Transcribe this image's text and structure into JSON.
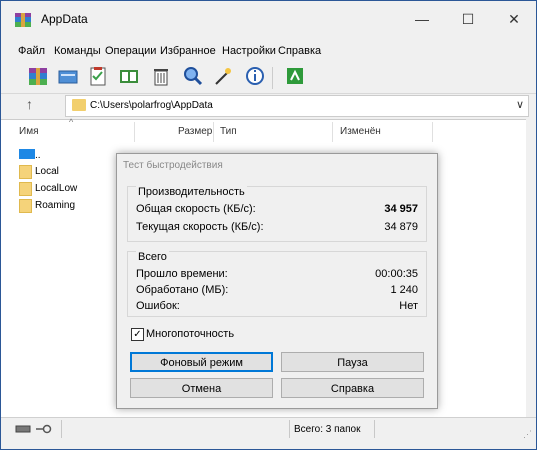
{
  "window": {
    "title": "AppData",
    "minimize_glyph": "—",
    "maximize_glyph": "☐",
    "close_glyph": "✕"
  },
  "menu": [
    "Файл",
    "Команды",
    "Операции",
    "Избранное",
    "Настройки",
    "Справка"
  ],
  "toolbar": {
    "icons": [
      "add-archive-icon",
      "extract-to-icon",
      "test-icon",
      "view-icon",
      "delete-icon",
      "find-icon",
      "wizard-icon",
      "info-icon",
      "repair-icon"
    ]
  },
  "address": {
    "path": "C:\\Users\\polarfrog\\AppData",
    "up_glyph": "↑",
    "dropdown_glyph": "∨"
  },
  "filelist": {
    "columns": [
      "Имя",
      "Размер",
      "Тип",
      "Изменён"
    ],
    "sort_glyph": "^",
    "rows": [
      {
        "name": "..",
        "kind": "up"
      },
      {
        "name": "Local",
        "kind": "folder"
      },
      {
        "name": "LocalLow",
        "kind": "folder"
      },
      {
        "name": "Roaming",
        "kind": "folder"
      }
    ]
  },
  "status": {
    "text": "Всего: 3 папок"
  },
  "dialog": {
    "title": "Тест быстродействия",
    "performance": {
      "heading": "Производительность",
      "total_speed_label": "Общая скорость (КБ/с):",
      "total_speed_value": "34 957",
      "current_speed_label": "Текущая скорость (КБ/с):",
      "current_speed_value": "34 879"
    },
    "totals": {
      "heading": "Всего",
      "elapsed_label": "Прошло времени:",
      "elapsed_value": "00:00:35",
      "processed_label": "Обработано (МБ):",
      "processed_value": "1 240",
      "errors_label": "Ошибок:",
      "errors_value": "Нет"
    },
    "multithreading_label": "Многопоточность",
    "multithreading_checked": true,
    "check_glyph": "✓",
    "buttons": {
      "background": "Фоновый режим",
      "pause": "Пауза",
      "cancel": "Отмена",
      "help": "Справка"
    }
  },
  "colors": {
    "accent": "#0078d7",
    "folder": "#f2cf6d"
  }
}
